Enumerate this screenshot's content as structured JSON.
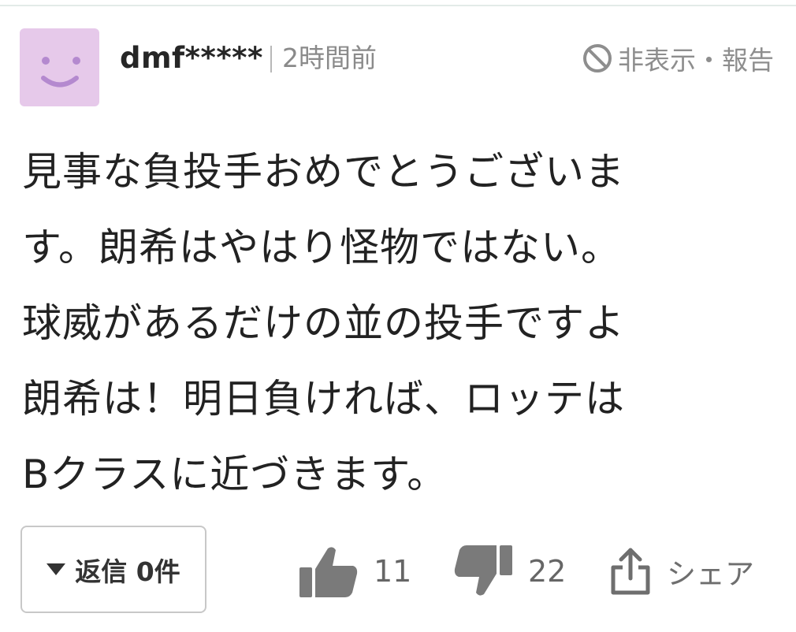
{
  "comment": {
    "user": {
      "avatar_icon": "smiley-face-icon",
      "avatar_color": "#e6c9ea",
      "username": "dmf*****",
      "timestamp": "2時間前"
    },
    "hide_report": {
      "icon": "prohibited-icon",
      "label": "非表示・報告"
    },
    "body_lines": [
      "見事な負投手おめでとうございま",
      "す。朗希はやはり怪物ではない。",
      "球威があるだけの並の投手ですよ",
      "朗希は！明日負ければ、ロッテは",
      "Bクラスに近づきます。"
    ],
    "actions": {
      "reply": {
        "icon": "triangle-down-icon",
        "label": "返信 0件"
      },
      "like": {
        "icon": "thumbs-up-icon",
        "count": "11"
      },
      "dislike": {
        "icon": "thumbs-down-icon",
        "count": "22"
      },
      "share": {
        "icon": "share-icon",
        "label": "シェア"
      }
    }
  }
}
